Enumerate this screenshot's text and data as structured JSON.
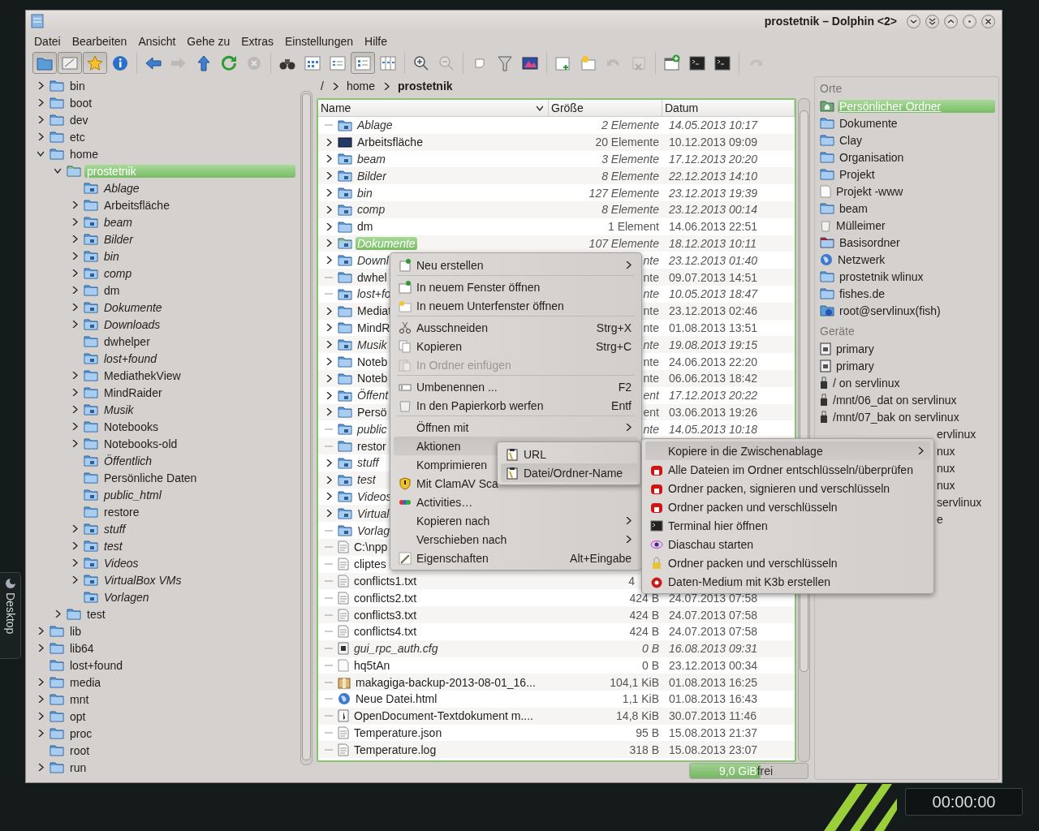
{
  "window": {
    "title": "prostetnik – Dolphin <2>",
    "buttons": [
      {
        "kind": "down"
      },
      {
        "kind": "double-down"
      },
      {
        "kind": "up"
      },
      {
        "kind": "minimize"
      },
      {
        "kind": "close"
      }
    ]
  },
  "menubar": [
    "Datei",
    "Bearbeiten",
    "Ansicht",
    "Gehe zu",
    "Extras",
    "Einstellungen",
    "Hilfe"
  ],
  "toolbar": {
    "groups": [
      {
        "buttons": [
          {
            "kind": "folder",
            "selected": true,
            "disabled": false
          },
          {
            "kind": "preview",
            "selected": true,
            "disabled": false
          },
          {
            "kind": "star",
            "selected": true,
            "disabled": false
          },
          {
            "kind": "info",
            "selected": false,
            "disabled": false
          }
        ]
      },
      {
        "buttons": [
          {
            "kind": "back",
            "selected": false,
            "disabled": false
          },
          {
            "kind": "forward",
            "selected": false,
            "disabled": true
          },
          {
            "kind": "up",
            "selected": false,
            "disabled": false
          },
          {
            "kind": "reload",
            "selected": false,
            "disabled": false
          },
          {
            "kind": "stop",
            "selected": false,
            "disabled": true
          }
        ]
      },
      {
        "buttons": [
          {
            "kind": "binoculars",
            "selected": false,
            "disabled": false
          },
          {
            "kind": "icons-view",
            "selected": false,
            "disabled": false
          },
          {
            "kind": "compact-view",
            "selected": false,
            "disabled": false
          },
          {
            "kind": "details-view",
            "selected": true,
            "disabled": false
          },
          {
            "kind": "columns-view",
            "selected": false,
            "disabled": false
          }
        ]
      },
      {
        "buttons": [
          {
            "kind": "zoom-in",
            "selected": false,
            "disabled": false
          },
          {
            "kind": "zoom-out",
            "selected": false,
            "disabled": true
          }
        ]
      },
      {
        "buttons": [
          {
            "kind": "note",
            "selected": false,
            "disabled": false
          },
          {
            "kind": "filter",
            "selected": false,
            "disabled": false
          },
          {
            "kind": "picture",
            "selected": false,
            "disabled": false
          }
        ]
      },
      {
        "buttons": [
          {
            "kind": "new-tab",
            "selected": false,
            "disabled": false
          },
          {
            "kind": "sun",
            "selected": false,
            "disabled": false
          },
          {
            "kind": "undo",
            "selected": false,
            "disabled": true
          },
          {
            "kind": "delete",
            "selected": false,
            "disabled": true
          }
        ]
      },
      {
        "buttons": [
          {
            "kind": "new-window",
            "selected": false,
            "disabled": false
          },
          {
            "kind": "terminal",
            "selected": false,
            "disabled": false
          },
          {
            "kind": "terminal",
            "selected": false,
            "disabled": false
          }
        ]
      },
      {
        "buttons": [
          {
            "kind": "redo",
            "selected": false,
            "disabled": true
          }
        ]
      }
    ]
  },
  "tree": [
    {
      "label": "bin",
      "kind": "branch",
      "expanded": false,
      "link": false,
      "selected": false
    },
    {
      "label": "boot",
      "kind": "branch",
      "expanded": false,
      "link": false,
      "selected": false
    },
    {
      "label": "dev",
      "kind": "branch",
      "expanded": false,
      "link": false,
      "selected": false
    },
    {
      "label": "etc",
      "kind": "branch",
      "expanded": false,
      "link": false,
      "selected": false
    },
    {
      "label": "home",
      "kind": "branch",
      "expanded": true,
      "link": false,
      "selected": false,
      "children": [
        {
          "label": "prostetnik",
          "kind": "branch",
          "expanded": true,
          "link": false,
          "selected": true,
          "children": [
            {
              "label": "Ablage",
              "kind": "leaf",
              "link": true,
              "selected": false
            },
            {
              "label": "Arbeitsfläche",
              "kind": "branch",
              "expanded": false,
              "link": false,
              "selected": false
            },
            {
              "label": "beam",
              "kind": "branch",
              "expanded": false,
              "link": true,
              "selected": false
            },
            {
              "label": "Bilder",
              "kind": "branch",
              "expanded": false,
              "link": true,
              "selected": false
            },
            {
              "label": "bin",
              "kind": "branch",
              "expanded": false,
              "link": true,
              "selected": false
            },
            {
              "label": "comp",
              "kind": "branch",
              "expanded": false,
              "link": true,
              "selected": false
            },
            {
              "label": "dm",
              "kind": "branch",
              "expanded": false,
              "link": false,
              "selected": false
            },
            {
              "label": "Dokumente",
              "kind": "branch",
              "expanded": false,
              "link": true,
              "selected": false
            },
            {
              "label": "Downloads",
              "kind": "branch",
              "expanded": false,
              "link": true,
              "selected": false
            },
            {
              "label": "dwhelper",
              "kind": "leaf",
              "link": false,
              "selected": false
            },
            {
              "label": "lost+found",
              "kind": "leaf",
              "link": true,
              "selected": false
            },
            {
              "label": "MediathekView",
              "kind": "branch",
              "expanded": false,
              "link": false,
              "selected": false
            },
            {
              "label": "MindRaider",
              "kind": "branch",
              "expanded": false,
              "link": false,
              "selected": false
            },
            {
              "label": "Musik",
              "kind": "branch",
              "expanded": false,
              "link": true,
              "selected": false
            },
            {
              "label": "Notebooks",
              "kind": "branch",
              "expanded": false,
              "link": false,
              "selected": false
            },
            {
              "label": "Notebooks-old",
              "kind": "branch",
              "expanded": false,
              "link": false,
              "selected": false
            },
            {
              "label": "Öffentlich",
              "kind": "leaf",
              "link": true,
              "selected": false
            },
            {
              "label": "Persönliche Daten",
              "kind": "leaf",
              "link": false,
              "selected": false
            },
            {
              "label": "public_html",
              "kind": "leaf",
              "link": true,
              "selected": false
            },
            {
              "label": "restore",
              "kind": "leaf",
              "link": false,
              "selected": false
            },
            {
              "label": "stuff",
              "kind": "branch",
              "expanded": false,
              "link": true,
              "selected": false
            },
            {
              "label": "test",
              "kind": "branch",
              "expanded": false,
              "link": true,
              "selected": false
            },
            {
              "label": "Videos",
              "kind": "branch",
              "expanded": false,
              "link": true,
              "selected": false
            },
            {
              "label": "VirtualBox VMs",
              "kind": "branch",
              "expanded": false,
              "link": true,
              "selected": false
            },
            {
              "label": "Vorlagen",
              "kind": "leaf",
              "link": true,
              "selected": false
            }
          ]
        },
        {
          "label": "test",
          "kind": "branch",
          "expanded": false,
          "link": false,
          "selected": false
        }
      ]
    },
    {
      "label": "lib",
      "kind": "branch",
      "expanded": false,
      "link": false,
      "selected": false
    },
    {
      "label": "lib64",
      "kind": "branch",
      "expanded": false,
      "link": false,
      "selected": false
    },
    {
      "label": "lost+found",
      "kind": "leaf",
      "link": false,
      "selected": false
    },
    {
      "label": "media",
      "kind": "branch",
      "expanded": false,
      "link": false,
      "selected": false
    },
    {
      "label": "mnt",
      "kind": "branch",
      "expanded": false,
      "link": false,
      "selected": false
    },
    {
      "label": "opt",
      "kind": "branch",
      "expanded": false,
      "link": false,
      "selected": false
    },
    {
      "label": "proc",
      "kind": "branch",
      "expanded": false,
      "link": false,
      "selected": false
    },
    {
      "label": "root",
      "kind": "leaf",
      "link": false,
      "selected": false
    },
    {
      "label": "run",
      "kind": "branch",
      "expanded": false,
      "link": false,
      "selected": false
    }
  ],
  "breadcrumb": [
    {
      "label": "/",
      "current": false
    },
    {
      "label": "home",
      "current": false
    },
    {
      "label": "prostetnik",
      "current": true
    }
  ],
  "table": {
    "columns": [
      "Name",
      "Größe",
      "Datum"
    ],
    "rows": [
      {
        "name": "Ablage",
        "size": "2 Elemente",
        "date": "14.05.2013 10:17",
        "kind": "folder-link",
        "expandable": false,
        "link": true,
        "selected": false
      },
      {
        "name": "Arbeitsfläche",
        "size": "20 Elemente",
        "date": "10.12.2013 09:09",
        "kind": "desktop",
        "expandable": true,
        "link": false,
        "selected": false
      },
      {
        "name": "beam",
        "size": "3 Elemente",
        "date": "17.12.2013 20:20",
        "kind": "folder-link",
        "expandable": true,
        "link": true,
        "selected": false
      },
      {
        "name": "Bilder",
        "size": "8 Elemente",
        "date": "22.12.2013 14:10",
        "kind": "folder-link",
        "expandable": true,
        "link": true,
        "selected": false
      },
      {
        "name": "bin",
        "size": "127 Elemente",
        "date": "23.12.2013 19:39",
        "kind": "folder-link",
        "expandable": true,
        "link": true,
        "selected": false
      },
      {
        "name": "comp",
        "size": "8 Elemente",
        "date": "23.12.2013 00:14",
        "kind": "folder-link",
        "expandable": true,
        "link": true,
        "selected": false
      },
      {
        "name": "dm",
        "size": "1 Element",
        "date": "14.06.2013 22:51",
        "kind": "folder",
        "expandable": true,
        "link": false,
        "selected": false
      },
      {
        "name": "Dokumente",
        "size": "107 Elemente",
        "date": "18.12.2013 10:11",
        "kind": "folder-link",
        "expandable": true,
        "link": true,
        "selected": true
      },
      {
        "name": "Downl",
        "size": "nte",
        "date": "23.12.2013 01:40",
        "kind": "folder-link",
        "expandable": true,
        "link": true,
        "selected": false
      },
      {
        "name": "dwhel",
        "size": "nte",
        "date": "09.07.2013 14:51",
        "kind": "folder",
        "expandable": false,
        "link": false,
        "selected": false
      },
      {
        "name": "lost+fo",
        "size": "nte",
        "date": "10.05.2013 18:47",
        "kind": "folder-link",
        "expandable": false,
        "link": true,
        "selected": false
      },
      {
        "name": "Mediat",
        "size": "nte",
        "date": "23.12.2013 02:46",
        "kind": "folder",
        "expandable": true,
        "link": false,
        "selected": false
      },
      {
        "name": "MindR",
        "size": "nte",
        "date": "01.08.2013 13:51",
        "kind": "folder",
        "expandable": true,
        "link": false,
        "selected": false
      },
      {
        "name": "Musik",
        "size": "nte",
        "date": "19.08.2013 19:15",
        "kind": "folder-link",
        "expandable": true,
        "link": true,
        "selected": false
      },
      {
        "name": "Noteb",
        "size": "nte",
        "date": "24.06.2013 22:20",
        "kind": "folder",
        "expandable": true,
        "link": false,
        "selected": false
      },
      {
        "name": "Noteb",
        "size": "nte",
        "date": "06.06.2013 18:42",
        "kind": "folder",
        "expandable": true,
        "link": false,
        "selected": false
      },
      {
        "name": "Öffent",
        "size": "ent",
        "date": "17.12.2013 20:22",
        "kind": "folder-link",
        "expandable": true,
        "link": true,
        "selected": false
      },
      {
        "name": "Persö",
        "size": "ent",
        "date": "03.06.2013 19:26",
        "kind": "folder",
        "expandable": true,
        "link": false,
        "selected": false
      },
      {
        "name": "public",
        "size": "nte",
        "date": "14.05.2013 10:18",
        "kind": "folder-link",
        "expandable": false,
        "link": true,
        "selected": false
      },
      {
        "name": "restor",
        "kind": "folder",
        "expandable": false,
        "link": false,
        "selected": false
      },
      {
        "name": "stuff",
        "kind": "folder-link",
        "expandable": true,
        "link": true,
        "selected": false
      },
      {
        "name": "test",
        "kind": "folder-link",
        "expandable": true,
        "link": true,
        "selected": false
      },
      {
        "name": "Videos",
        "kind": "folder-link",
        "expandable": true,
        "link": true,
        "selected": false
      },
      {
        "name": "Virtual",
        "kind": "folder-link",
        "expandable": true,
        "link": true,
        "selected": false
      },
      {
        "name": "Vorlag",
        "kind": "folder-link",
        "expandable": false,
        "link": true,
        "selected": false
      },
      {
        "name": "C:\\npp",
        "kind": "text",
        "expandable": false,
        "link": false,
        "selected": false
      },
      {
        "name": "cliptes",
        "kind": "text",
        "expandable": false,
        "link": false,
        "selected": false
      },
      {
        "name": "conflicts1.txt",
        "size": "4",
        "kind": "text",
        "expandable": false,
        "link": false,
        "selected": false
      },
      {
        "name": "conflicts2.txt",
        "size": "424 B",
        "date": "24.07.2013 07:58",
        "kind": "text",
        "expandable": false,
        "link": false,
        "selected": false
      },
      {
        "name": "conflicts3.txt",
        "size": "424 B",
        "date": "24.07.2013 07:58",
        "kind": "text",
        "expandable": false,
        "link": false,
        "selected": false
      },
      {
        "name": "conflicts4.txt",
        "size": "424 B",
        "date": "24.07.2013 07:58",
        "kind": "text",
        "expandable": false,
        "link": false,
        "selected": false
      },
      {
        "name": "gui_rpc_auth.cfg",
        "size": "0 B",
        "date": "16.08.2013 09:31",
        "kind": "config",
        "expandable": false,
        "link": true,
        "selected": false
      },
      {
        "name": "hq5tAn",
        "size": "0 B",
        "date": "23.12.2013 00:34",
        "kind": "blank",
        "expandable": false,
        "link": false,
        "selected": false
      },
      {
        "name": "makagiga-backup-2013-08-01_16...",
        "size": "104,1 KiB",
        "date": "01.08.2013 16:25",
        "kind": "archive",
        "expandable": false,
        "link": false,
        "selected": false
      },
      {
        "name": "Neue Datei.html",
        "size": "1,1 KiB",
        "date": "01.08.2013 16:43",
        "kind": "html",
        "expandable": false,
        "link": false,
        "selected": false
      },
      {
        "name": "OpenDocument-Textdokument m....",
        "size": "14,8 KiB",
        "date": "30.07.2013 11:46",
        "kind": "odt",
        "expandable": false,
        "link": false,
        "selected": false
      },
      {
        "name": "Temperature.json",
        "size": "95 B",
        "date": "15.08.2013 21:37",
        "kind": "text",
        "expandable": false,
        "link": false,
        "selected": false
      },
      {
        "name": "Temperature.log",
        "size": "318 B",
        "date": "15.08.2013 23:07",
        "kind": "text",
        "expandable": false,
        "link": false,
        "selected": false
      }
    ]
  },
  "free_space": {
    "label": "9,0 GiB",
    "suffix": "frei",
    "level": 0.6
  },
  "places": {
    "title": "Orte",
    "items": [
      {
        "label": "Persönlicher Ordner",
        "kind": "home",
        "selected": true
      },
      {
        "label": "Dokumente",
        "kind": "folder",
        "selected": false
      },
      {
        "label": "Clay",
        "kind": "folder",
        "selected": false
      },
      {
        "label": "Organisation",
        "kind": "folder",
        "selected": false
      },
      {
        "label": "Projekt",
        "kind": "folder",
        "selected": false
      },
      {
        "label": "Projekt -www",
        "kind": "blank",
        "selected": false
      },
      {
        "label": "beam",
        "kind": "folder",
        "selected": false
      },
      {
        "label": "Mülleimer",
        "kind": "trash",
        "selected": false
      },
      {
        "label": "Basisordner",
        "kind": "red-folder",
        "selected": false
      },
      {
        "label": "Netzwerk",
        "kind": "globe",
        "selected": false
      },
      {
        "label": "prostetnik wlinux",
        "kind": "folder",
        "selected": false
      },
      {
        "label": "fishes.de",
        "kind": "folder",
        "selected": false
      },
      {
        "label": "root@servlinux(fish)",
        "kind": "folder-globe",
        "selected": false
      }
    ]
  },
  "devices": {
    "title": "Geräte",
    "items": [
      {
        "label": "primary",
        "kind": "drive"
      },
      {
        "label": "primary",
        "kind": "drive"
      },
      {
        "label": "/ on servlinux",
        "kind": "usb"
      },
      {
        "label": "/mnt/06_dat on servlinux",
        "kind": "usb"
      },
      {
        "label": "/mnt/07_bak on servlinux",
        "kind": "usb"
      },
      {
        "label": "ervlinux",
        "kind": "covered"
      },
      {
        "label": "nux",
        "kind": "covered"
      },
      {
        "label": "nux",
        "kind": "covered"
      },
      {
        "label": "nux",
        "kind": "covered"
      },
      {
        "label": "servlinux",
        "kind": "covered"
      },
      {
        "label": "e",
        "kind": "covered"
      }
    ]
  },
  "context_menu": [
    {
      "kind": "new",
      "label": "Neu erstellen",
      "submenu": true,
      "disabled": false,
      "selected": false
    },
    {
      "kind": "separator"
    },
    {
      "kind": "window-new",
      "label": "In neuem Fenster öffnen",
      "submenu": false,
      "disabled": false,
      "selected": false
    },
    {
      "kind": "tab-new",
      "label": "In neuem Unterfenster öffnen",
      "submenu": false,
      "disabled": false,
      "selected": false
    },
    {
      "kind": "separator"
    },
    {
      "kind": "cut",
      "label": "Ausschneiden",
      "shortcut": "Strg+X",
      "submenu": false,
      "disabled": false,
      "selected": false
    },
    {
      "kind": "copy",
      "label": "Kopieren",
      "shortcut": "Strg+C",
      "submenu": false,
      "disabled": false,
      "selected": false
    },
    {
      "kind": "paste",
      "label": "In Ordner einfügen",
      "submenu": false,
      "disabled": true,
      "selected": false
    },
    {
      "kind": "separator"
    },
    {
      "kind": "rename",
      "label": "Umbenennen ...",
      "shortcut": "F2",
      "submenu": false,
      "disabled": false,
      "selected": false
    },
    {
      "kind": "trash",
      "label": "In den Papierkorb werfen",
      "shortcut": "Entf",
      "submenu": false,
      "disabled": false,
      "selected": false
    },
    {
      "kind": "separator"
    },
    {
      "kind": "plain",
      "label": "Öffnen mit",
      "submenu": true,
      "disabled": false,
      "selected": false
    },
    {
      "kind": "plain",
      "label": "Aktionen",
      "submenu": false,
      "disabled": false,
      "selected": true
    },
    {
      "kind": "plain",
      "label": "Komprimieren",
      "submenu": false,
      "disabled": false,
      "selected": false
    },
    {
      "kind": "shield",
      "label": "Mit ClamAV Sca",
      "submenu": false,
      "disabled": false,
      "selected": false
    },
    {
      "kind": "activities",
      "label": "Activities…",
      "submenu": false,
      "disabled": false,
      "selected": false
    },
    {
      "kind": "plain",
      "label": "Kopieren nach",
      "submenu": true,
      "disabled": false,
      "selected": false
    },
    {
      "kind": "plain",
      "label": "Verschieben nach",
      "submenu": true,
      "disabled": false,
      "selected": false
    },
    {
      "kind": "properties",
      "label": "Eigenschaften",
      "shortcut": "Alt+Eingabe",
      "submenu": false,
      "disabled": false,
      "selected": false
    }
  ],
  "actions_submenu": [
    {
      "label": "URL",
      "kind": "clipboard",
      "selected": false
    },
    {
      "label": "Datei/Ordner-Name",
      "kind": "clipboard",
      "selected": true
    }
  ],
  "clipboard_submenu": [
    {
      "label": "Kopiere in die Zwischenablage",
      "kind": "plain",
      "submenu": true,
      "selected": true
    },
    {
      "label": "Alle Dateien im Ordner entschlüsseln/überprüfen",
      "kind": "gpg",
      "submenu": false,
      "selected": false
    },
    {
      "label": "Ordner packen, signieren und verschlüsseln",
      "kind": "gpg",
      "submenu": false,
      "selected": false
    },
    {
      "label": "Ordner packen und verschlüsseln",
      "kind": "gpg",
      "submenu": false,
      "selected": false
    },
    {
      "label": "Terminal hier öffnen",
      "kind": "terminal",
      "submenu": false,
      "selected": false
    },
    {
      "label": "Diaschau starten",
      "kind": "eye",
      "submenu": false,
      "selected": false
    },
    {
      "label": "Ordner packen und verschlüsseln",
      "kind": "lock",
      "submenu": false,
      "selected": false
    },
    {
      "label": "Daten-Medium mit K3b erstellen",
      "kind": "k3b",
      "submenu": false,
      "selected": false
    }
  ],
  "desktop_tab": {
    "label": "Desktop"
  },
  "clock": {
    "time": "00:00:00"
  }
}
